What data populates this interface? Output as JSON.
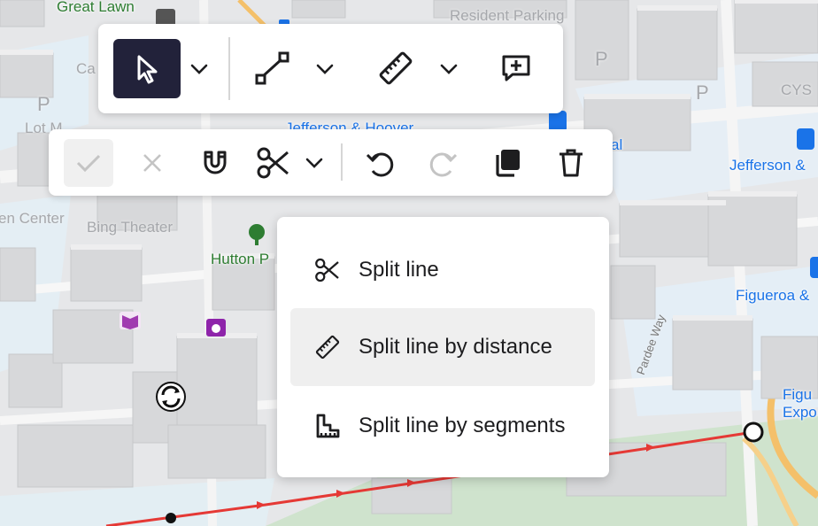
{
  "map": {
    "labels": {
      "great_lawn": "Great Lawn",
      "resident_parking": "Resident Parking",
      "jefferson_hoover": "Jefferson & Hoover",
      "jefferson_right": "Jefferson &",
      "bing_theater": "Bing Theater",
      "hutton": "Hutton P",
      "figueroa": "Figueroa &",
      "figu_top": "Figu",
      "figu_bottom": "Expo",
      "pardee_way": "Pardee Way",
      "center": "en Center",
      "lot_m": "Lot M",
      "cys": "CYS",
      "ca": "Ca",
      "al": "al"
    },
    "parking_symbol": "P"
  },
  "toolbar_main": {
    "tools": [
      {
        "name": "select",
        "icon": "cursor-arrow-icon",
        "active": true
      },
      {
        "name": "draw-line",
        "icon": "polyline-icon",
        "active": false
      },
      {
        "name": "measure",
        "icon": "ruler-icon",
        "active": false
      },
      {
        "name": "add-note",
        "icon": "message-plus-icon",
        "active": false
      }
    ]
  },
  "toolbar_edit": {
    "tools": [
      {
        "name": "confirm",
        "icon": "check-icon",
        "enabled": false
      },
      {
        "name": "cancel",
        "icon": "close-icon",
        "enabled": false
      },
      {
        "name": "snap",
        "icon": "magnet-icon",
        "enabled": true
      },
      {
        "name": "split",
        "icon": "scissors-icon",
        "enabled": true
      },
      {
        "name": "undo",
        "icon": "undo-icon",
        "enabled": true
      },
      {
        "name": "redo",
        "icon": "redo-icon",
        "enabled": false
      },
      {
        "name": "duplicate",
        "icon": "copy-icon",
        "enabled": true
      },
      {
        "name": "delete",
        "icon": "trash-icon",
        "enabled": true
      }
    ]
  },
  "split_menu": {
    "items": [
      {
        "label": "Split line",
        "icon": "scissors-icon",
        "highlighted": false
      },
      {
        "label": "Split line by distance",
        "icon": "ruler-icon",
        "highlighted": true
      },
      {
        "label": "Split line by segments",
        "icon": "segments-icon",
        "highlighted": false
      }
    ]
  },
  "colors": {
    "active_tool_bg": "#22223a",
    "route_line": "#e53935",
    "menu_highlight": "#efefef",
    "icon_dark": "#1d1d1f",
    "icon_disabled": "#c4c4c4"
  }
}
